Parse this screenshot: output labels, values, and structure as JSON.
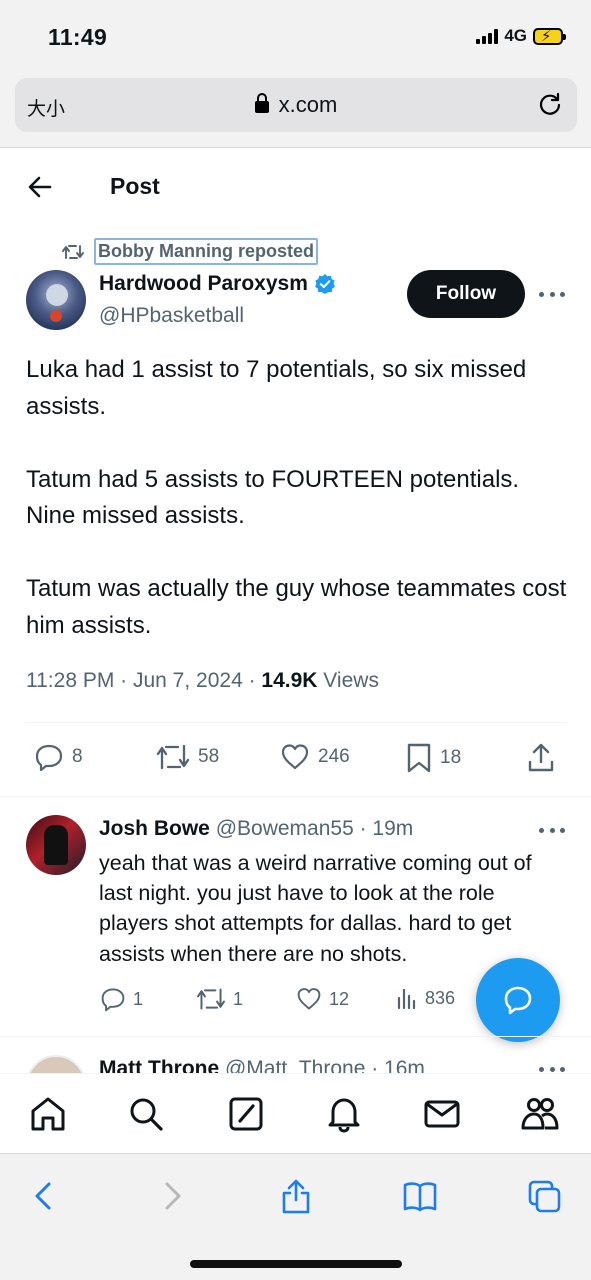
{
  "status_bar": {
    "time": "11:49",
    "network": "4G"
  },
  "browser": {
    "text_size_label": "大小",
    "domain": "x.com"
  },
  "header": {
    "title": "Post"
  },
  "post": {
    "reposted_by": "Bobby Manning reposted",
    "author_name": "Hardwood Paroxysm",
    "author_handle": "@HPbasketball",
    "follow_label": "Follow",
    "paragraphs": [
      "Luka had 1 assist to 7 potentials, so six missed assists.",
      "Tatum had 5 assists to FOURTEEN potentials. Nine missed assists.",
      "Tatum was actually the guy whose teammates cost him assists."
    ],
    "meta_time": "11:28 PM · Jun 7, 2024 · ",
    "views_count": "14.9K",
    "views_label": " Views",
    "replies": "8",
    "reposts": "58",
    "likes": "246",
    "bookmarks": "18"
  },
  "reply": {
    "name": "Josh Bowe",
    "handle_time": " @Boweman55 · 19m",
    "text": "yeah that was a weird narrative coming out of last night. you just have to look at the role players shot attempts for dallas. hard to get assists when there are no shots.",
    "replies": "1",
    "reposts": "1",
    "likes": "12",
    "views": "836"
  },
  "next_reply": {
    "name": "Matt Throne",
    "handle_time": " @Matt_Throne · 16m"
  },
  "colors": {
    "accent": "#1d9bf0",
    "text": "#0f1419",
    "secondary": "#536471"
  },
  "icons": {
    "tabbar": [
      "home-icon",
      "search-icon",
      "grok-icon",
      "bell-icon",
      "mail-icon",
      "communities-icon"
    ],
    "safari": [
      "back-icon",
      "forward-icon",
      "share-icon",
      "bookmarks-icon",
      "tabs-icon"
    ]
  }
}
